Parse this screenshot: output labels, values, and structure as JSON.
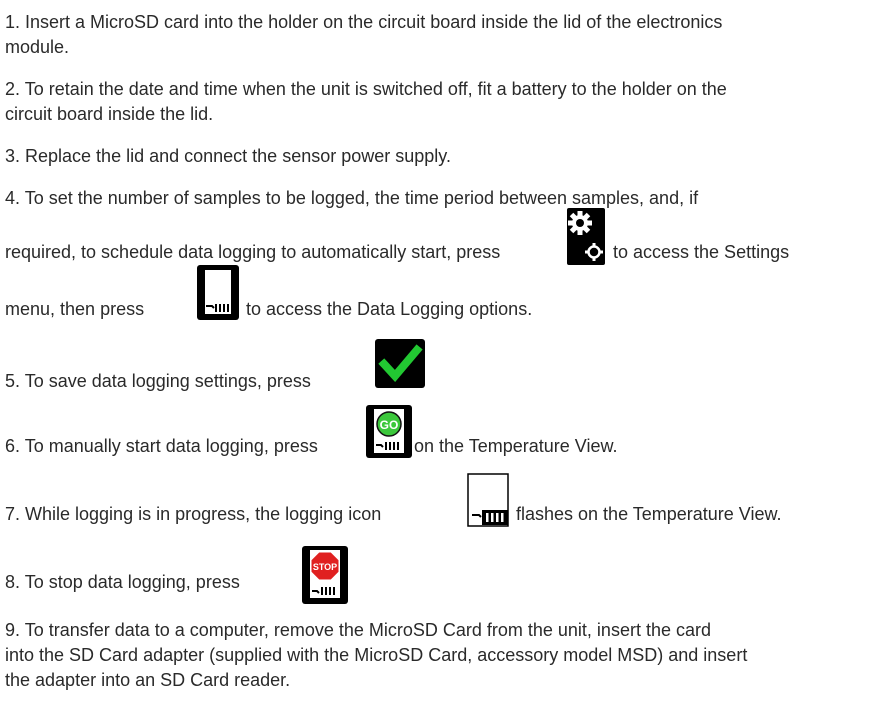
{
  "steps": {
    "s1": {
      "line1": "1. Insert a MicroSD card into the holder on the circuit board inside the lid of the electronics",
      "line2": "module."
    },
    "s2": {
      "line1": "2. To retain the date and time when the unit is switched off, fit a battery to the holder on the",
      "line2": "circuit board inside the lid."
    },
    "s3": {
      "line1": "3. Replace the lid and connect the sensor power supply."
    },
    "s4": {
      "line1": "4. To set the number of samples to be logged, the time period between samples, and, if",
      "line2a": "required, to schedule data logging to automatically start, press",
      "line2b": "to access the Settings",
      "line3a": "menu, then press",
      "line3b": "to access the Data Logging options."
    },
    "s5": {
      "line1": "5. To save data logging settings, press"
    },
    "s6": {
      "a": "6. To manually start data logging, press",
      "b": "on the Temperature View."
    },
    "s7": {
      "a": "7. While logging is in progress, the logging icon",
      "b": "flashes on the Temperature View."
    },
    "s8": {
      "line1": "8. To stop data logging, press"
    },
    "s9": {
      "line1": "9. To transfer data to a computer, remove the MicroSD Card from the unit, insert the card",
      "line2": "into the SD Card adapter (supplied with the MicroSD Card, accessory model MSD) and insert",
      "line3": "the adapter into an SD Card reader."
    }
  },
  "icons": {
    "settings": {
      "name": "settings-gear-icon"
    },
    "data_logging": {
      "name": "sd-card-icon"
    },
    "save": {
      "name": "checkmark-icon",
      "color": "#22c832"
    },
    "go": {
      "name": "go-logging-icon",
      "label": "GO",
      "color": "#3cc83c"
    },
    "logging": {
      "name": "logging-indicator-icon"
    },
    "stop": {
      "name": "stop-logging-icon",
      "label": "STOP",
      "color": "#e02020"
    }
  }
}
